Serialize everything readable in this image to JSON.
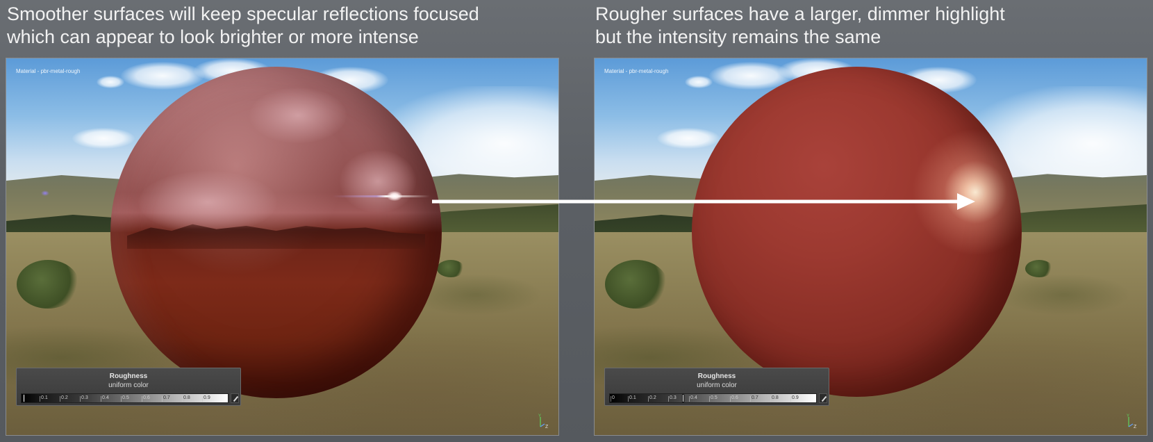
{
  "captions": {
    "left": {
      "line1": "Smoother surfaces will keep specular reflections focused",
      "line2": "which can appear to look brighter or more intense"
    },
    "right": {
      "line1": "Rougher surfaces have a larger, dimmer highlight",
      "line2": "but the intensity remains the same"
    }
  },
  "viewports": {
    "left": {
      "material_label": "Material - pbr-metal-rough",
      "panel_title": "Roughness",
      "panel_subtitle": "uniform color",
      "roughness_value": 0.0,
      "ticks": [
        "0.1",
        "0.2",
        "0.3",
        "0.4",
        "0.5",
        "0.6",
        "0.7",
        "0.8",
        "0.9"
      ]
    },
    "right": {
      "material_label": "Material - pbr-metal-rough",
      "panel_title": "Roughness",
      "panel_subtitle": "uniform color",
      "roughness_value": 0.35,
      "ticks": [
        "0",
        "0.1",
        "0.2",
        "0.3",
        "0.4",
        "0.5",
        "0.6",
        "0.7",
        "0.8",
        "0.9"
      ]
    }
  },
  "axis_gizmo": {
    "y": "Y",
    "z": "Z"
  },
  "icons": {
    "edit": "pencil-icon",
    "axis": "axis-gizmo-icon",
    "arrow": "arrow-right-icon"
  },
  "colors": {
    "background": "#5c6065",
    "caption_text": "#f2f2f2",
    "arrow": "#ffffff",
    "sphere_red": "#8f3329"
  }
}
